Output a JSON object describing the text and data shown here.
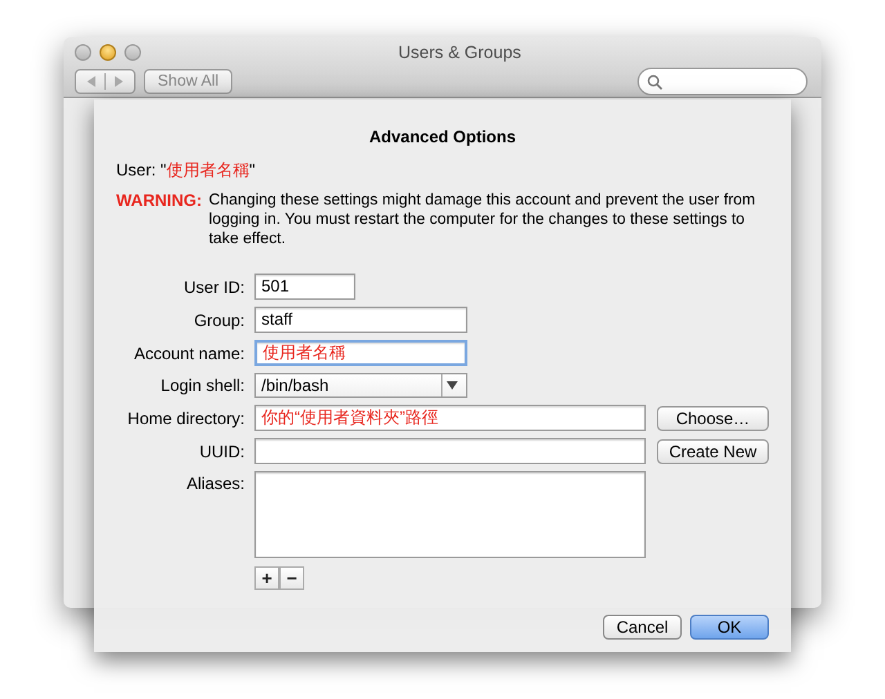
{
  "window": {
    "title": "Users & Groups"
  },
  "toolbar": {
    "show_all": "Show All"
  },
  "sheet": {
    "title": "Advanced Options",
    "user_line": {
      "prefix": "User: \"",
      "name": "使用者名稱",
      "suffix": "\""
    },
    "warning": {
      "label": "WARNING:",
      "text": "Changing these settings might damage this account and prevent the user from logging in. You must restart the computer for the changes to these settings to take effect."
    },
    "fields": [
      {
        "kind": "short",
        "label": "User ID:",
        "value": "501",
        "color": "#000000",
        "focused": false
      },
      {
        "kind": "medium",
        "label": "Group:",
        "value": "staff",
        "color": "#000000",
        "focused": false
      },
      {
        "kind": "medium",
        "label": "Account name:",
        "value": "使用者名稱",
        "color": "#e8261e",
        "focused": true
      },
      {
        "kind": "popup",
        "label": "Login shell:",
        "value": "/bin/bash",
        "color": "#000000",
        "focused": false
      },
      {
        "kind": "wide",
        "label": "Home directory:",
        "value": "你的“使用者資料夾”路徑",
        "color": "#e8261e",
        "focused": false,
        "button": "Choose…"
      },
      {
        "kind": "wide",
        "label": "UUID:",
        "focused": false,
        "button": "Create New"
      },
      {
        "kind": "list",
        "label": "Aliases:",
        "add": "+",
        "remove": "−"
      }
    ],
    "buttons": [
      {
        "label": "Cancel",
        "default": false
      },
      {
        "label": "OK",
        "default": true
      }
    ]
  }
}
